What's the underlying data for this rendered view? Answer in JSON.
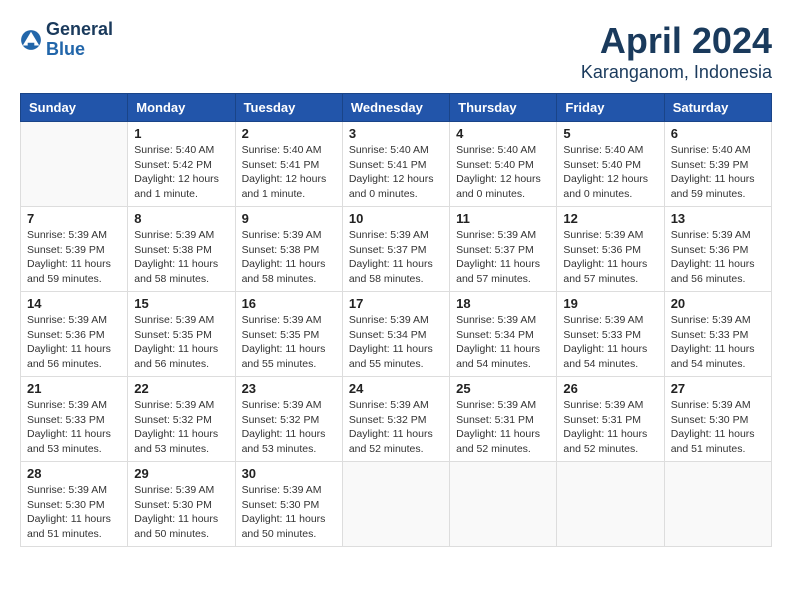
{
  "header": {
    "logo_general": "General",
    "logo_blue": "Blue",
    "month_title": "April 2024",
    "location": "Karanganom, Indonesia"
  },
  "days_of_week": [
    "Sunday",
    "Monday",
    "Tuesday",
    "Wednesday",
    "Thursday",
    "Friday",
    "Saturday"
  ],
  "weeks": [
    [
      {
        "day": "",
        "info": ""
      },
      {
        "day": "1",
        "info": "Sunrise: 5:40 AM\nSunset: 5:42 PM\nDaylight: 12 hours\nand 1 minute."
      },
      {
        "day": "2",
        "info": "Sunrise: 5:40 AM\nSunset: 5:41 PM\nDaylight: 12 hours\nand 1 minute."
      },
      {
        "day": "3",
        "info": "Sunrise: 5:40 AM\nSunset: 5:41 PM\nDaylight: 12 hours\nand 0 minutes."
      },
      {
        "day": "4",
        "info": "Sunrise: 5:40 AM\nSunset: 5:40 PM\nDaylight: 12 hours\nand 0 minutes."
      },
      {
        "day": "5",
        "info": "Sunrise: 5:40 AM\nSunset: 5:40 PM\nDaylight: 12 hours\nand 0 minutes."
      },
      {
        "day": "6",
        "info": "Sunrise: 5:40 AM\nSunset: 5:39 PM\nDaylight: 11 hours\nand 59 minutes."
      }
    ],
    [
      {
        "day": "7",
        "info": "Sunrise: 5:39 AM\nSunset: 5:39 PM\nDaylight: 11 hours\nand 59 minutes."
      },
      {
        "day": "8",
        "info": "Sunrise: 5:39 AM\nSunset: 5:38 PM\nDaylight: 11 hours\nand 58 minutes."
      },
      {
        "day": "9",
        "info": "Sunrise: 5:39 AM\nSunset: 5:38 PM\nDaylight: 11 hours\nand 58 minutes."
      },
      {
        "day": "10",
        "info": "Sunrise: 5:39 AM\nSunset: 5:37 PM\nDaylight: 11 hours\nand 58 minutes."
      },
      {
        "day": "11",
        "info": "Sunrise: 5:39 AM\nSunset: 5:37 PM\nDaylight: 11 hours\nand 57 minutes."
      },
      {
        "day": "12",
        "info": "Sunrise: 5:39 AM\nSunset: 5:36 PM\nDaylight: 11 hours\nand 57 minutes."
      },
      {
        "day": "13",
        "info": "Sunrise: 5:39 AM\nSunset: 5:36 PM\nDaylight: 11 hours\nand 56 minutes."
      }
    ],
    [
      {
        "day": "14",
        "info": "Sunrise: 5:39 AM\nSunset: 5:36 PM\nDaylight: 11 hours\nand 56 minutes."
      },
      {
        "day": "15",
        "info": "Sunrise: 5:39 AM\nSunset: 5:35 PM\nDaylight: 11 hours\nand 56 minutes."
      },
      {
        "day": "16",
        "info": "Sunrise: 5:39 AM\nSunset: 5:35 PM\nDaylight: 11 hours\nand 55 minutes."
      },
      {
        "day": "17",
        "info": "Sunrise: 5:39 AM\nSunset: 5:34 PM\nDaylight: 11 hours\nand 55 minutes."
      },
      {
        "day": "18",
        "info": "Sunrise: 5:39 AM\nSunset: 5:34 PM\nDaylight: 11 hours\nand 54 minutes."
      },
      {
        "day": "19",
        "info": "Sunrise: 5:39 AM\nSunset: 5:33 PM\nDaylight: 11 hours\nand 54 minutes."
      },
      {
        "day": "20",
        "info": "Sunrise: 5:39 AM\nSunset: 5:33 PM\nDaylight: 11 hours\nand 54 minutes."
      }
    ],
    [
      {
        "day": "21",
        "info": "Sunrise: 5:39 AM\nSunset: 5:33 PM\nDaylight: 11 hours\nand 53 minutes."
      },
      {
        "day": "22",
        "info": "Sunrise: 5:39 AM\nSunset: 5:32 PM\nDaylight: 11 hours\nand 53 minutes."
      },
      {
        "day": "23",
        "info": "Sunrise: 5:39 AM\nSunset: 5:32 PM\nDaylight: 11 hours\nand 53 minutes."
      },
      {
        "day": "24",
        "info": "Sunrise: 5:39 AM\nSunset: 5:32 PM\nDaylight: 11 hours\nand 52 minutes."
      },
      {
        "day": "25",
        "info": "Sunrise: 5:39 AM\nSunset: 5:31 PM\nDaylight: 11 hours\nand 52 minutes."
      },
      {
        "day": "26",
        "info": "Sunrise: 5:39 AM\nSunset: 5:31 PM\nDaylight: 11 hours\nand 52 minutes."
      },
      {
        "day": "27",
        "info": "Sunrise: 5:39 AM\nSunset: 5:30 PM\nDaylight: 11 hours\nand 51 minutes."
      }
    ],
    [
      {
        "day": "28",
        "info": "Sunrise: 5:39 AM\nSunset: 5:30 PM\nDaylight: 11 hours\nand 51 minutes."
      },
      {
        "day": "29",
        "info": "Sunrise: 5:39 AM\nSunset: 5:30 PM\nDaylight: 11 hours\nand 50 minutes."
      },
      {
        "day": "30",
        "info": "Sunrise: 5:39 AM\nSunset: 5:30 PM\nDaylight: 11 hours\nand 50 minutes."
      },
      {
        "day": "",
        "info": ""
      },
      {
        "day": "",
        "info": ""
      },
      {
        "day": "",
        "info": ""
      },
      {
        "day": "",
        "info": ""
      }
    ]
  ]
}
